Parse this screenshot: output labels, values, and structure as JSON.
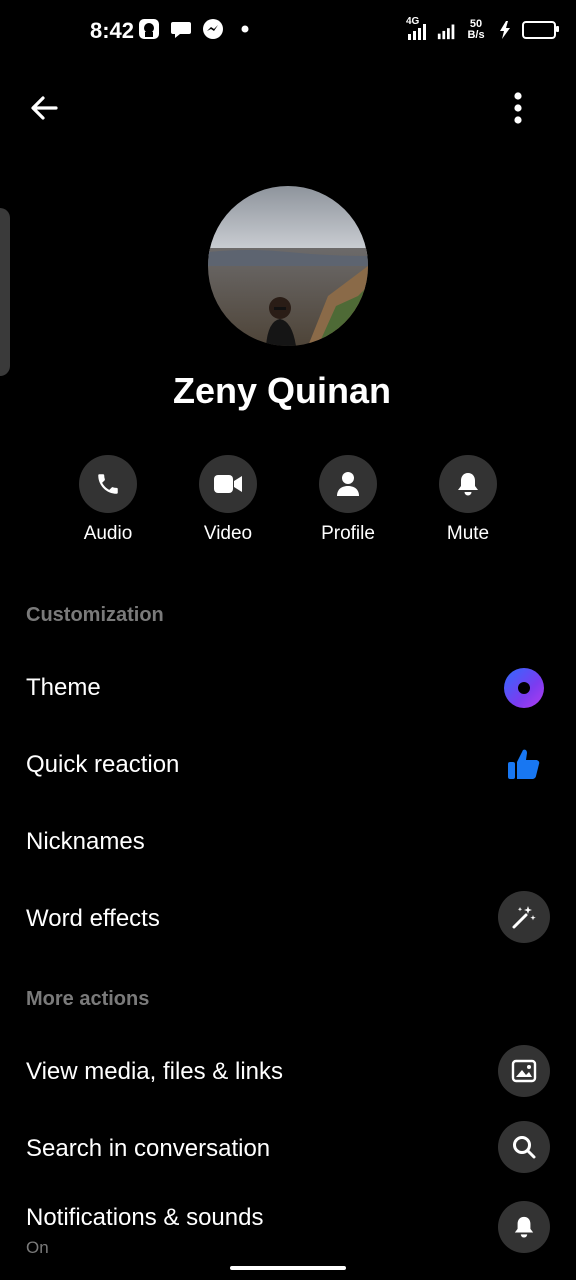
{
  "status_bar": {
    "time": "8:42",
    "network_type": "4G",
    "net_speed_value": "50",
    "net_speed_unit": "B/s",
    "icons": [
      "notification-app-icon",
      "chat-bubble-icon",
      "messenger-icon",
      "dot-icon"
    ]
  },
  "header": {
    "back_icon": "arrow-left-icon",
    "more_icon": "vertical-dots-icon"
  },
  "profile": {
    "name": "Zeny Quinan"
  },
  "actions": [
    {
      "label": "Audio",
      "icon": "phone-icon"
    },
    {
      "label": "Video",
      "icon": "video-camera-icon"
    },
    {
      "label": "Profile",
      "icon": "person-icon"
    },
    {
      "label": "Mute",
      "icon": "bell-icon"
    }
  ],
  "customization": {
    "header": "Customization",
    "items": [
      {
        "label": "Theme",
        "icon": "theme-swatch"
      },
      {
        "label": "Quick reaction",
        "icon": "thumbs-up-icon"
      },
      {
        "label": "Nicknames"
      },
      {
        "label": "Word effects",
        "icon": "magic-wand-icon"
      }
    ]
  },
  "more_actions": {
    "header": "More actions",
    "items": [
      {
        "label": "View media, files & links",
        "icon": "image-icon"
      },
      {
        "label": "Search in conversation",
        "icon": "search-icon"
      },
      {
        "label": "Notifications & sounds",
        "sub": "On",
        "icon": "bell-icon"
      }
    ]
  },
  "colors": {
    "background": "#000000",
    "text": "#ffffff",
    "section_header": "#7a7a7a",
    "icon_circle": "#333333",
    "accent_blue": "#1877f2"
  }
}
